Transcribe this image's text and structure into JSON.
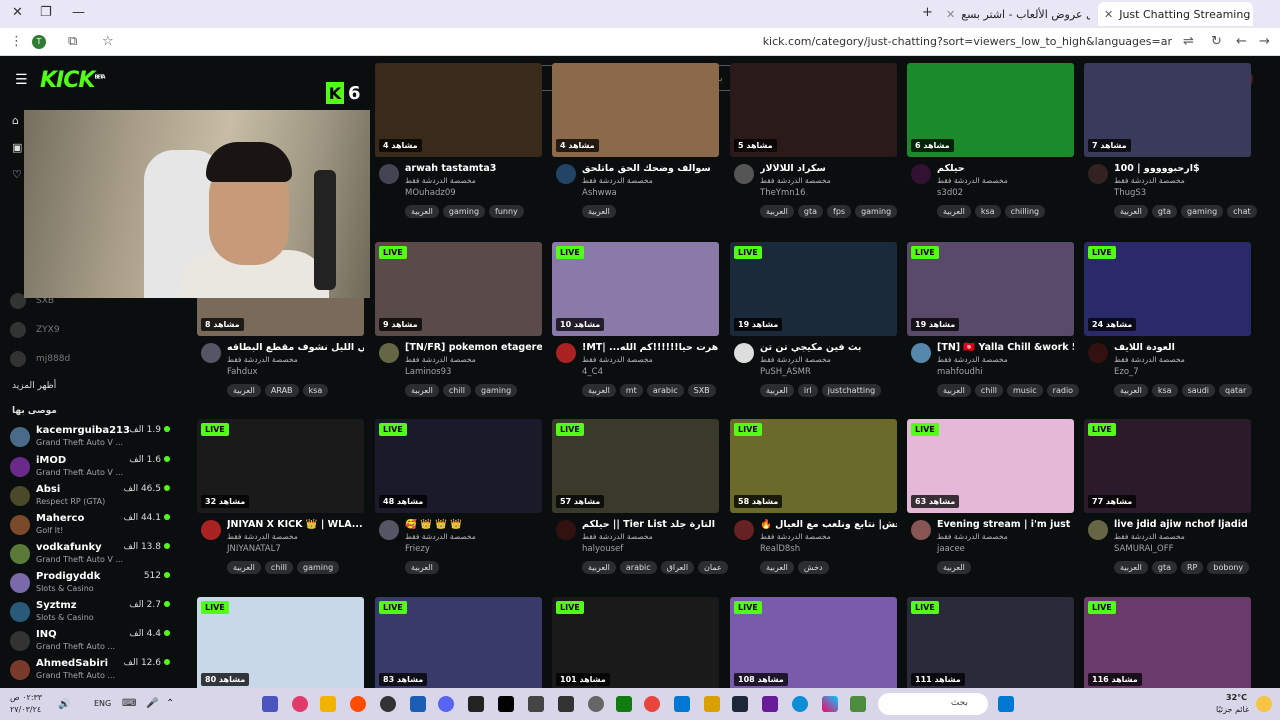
{
  "browser": {
    "tabs": [
      {
        "label": "Just Chatting Streaming - Live",
        "active": true
      },
      {
        "label": "أفضل عروض الألعاب - اشتر بسع",
        "active": false
      }
    ],
    "url": "kick.com/category/just-chatting?sort=viewers_low_to_high&languages=ar"
  },
  "kick": {
    "logo": "KICK",
    "logo_sup": "BETA",
    "search_placeholder": "بحث",
    "overlay_badge": "K",
    "overlay_count": "6"
  },
  "sidebar": {
    "offline": [
      "SXB",
      "ZYX9",
      "mj888d"
    ],
    "show_more": "أظهر المزيد",
    "recommended_heading": "موصى بها",
    "users": [
      {
        "name": "kacemrguiba213",
        "game": "Grand Theft Auto V ...",
        "viewers": "1.9 الف",
        "color": "#4a6a8a"
      },
      {
        "name": "iMOD",
        "game": "Grand Theft Auto V ...",
        "viewers": "1.6 الف",
        "color": "#6a2a8a"
      },
      {
        "name": "Absi",
        "game": "Respect RP (GTA)",
        "viewers": "46.5 الف",
        "color": "#4a4a2a"
      },
      {
        "name": "Maherco",
        "game": "Golf It!",
        "viewers": "44.1 الف",
        "color": "#7a4a2a"
      },
      {
        "name": "vodkafunky",
        "game": "Grand Theft Auto V ...",
        "viewers": "13.8 الف",
        "color": "#5a7a3a"
      },
      {
        "name": "Prodigyddk",
        "game": "Slots & Casino",
        "viewers": "512",
        "color": "#7a6aaa"
      },
      {
        "name": "Syztmz",
        "game": "Slots & Casino",
        "viewers": "2.7 الف",
        "color": "#2a5a7a"
      },
      {
        "name": "INQ",
        "game": "Grand Theft Auto ...",
        "viewers": "4.4 الف",
        "color": "#333333"
      },
      {
        "name": "AhmedSabiri",
        "game": "Grand Theft Auto ...",
        "viewers": "12.6 الف",
        "color": "#7a3a2a"
      }
    ]
  },
  "category_label": "مخصصة الدردشة فقط",
  "live_label": "LIVE",
  "rows": [
    [
      {
        "viewers": "4 مشاهد",
        "title": "arwah tastamta3",
        "user": "MOuhadz09",
        "tags": [
          "العربية",
          "gaming",
          "funny"
        ],
        "bg": "#3a2a1a",
        "av": "#445"
      },
      {
        "viewers": "4 مشاهد",
        "title": "سوالف وضحك الحق ماتلحق",
        "user": "Ashwwa",
        "tags": [
          "العربية"
        ],
        "bg": "#8a6a4a",
        "av": "#246"
      },
      {
        "viewers": "5 مشاهد",
        "title": "سكراد اللالالار",
        "user": "TheYmn16",
        "tags": [
          "العربية",
          "gta",
          "fps",
          "gaming"
        ],
        "bg": "#2a1a1a",
        "av": "#555"
      },
      {
        "viewers": "6 مشاهد",
        "title": "حيلكم",
        "user": "s3d02",
        "tags": [
          "العربية",
          "ksa",
          "chilling"
        ],
        "bg": "#1a8a2a",
        "av": "#313"
      },
      {
        "viewers": "7 مشاهد",
        "title": "ارحبووووو | 100$",
        "user": "ThugS3",
        "tags": [
          "العربية",
          "gta",
          "gaming",
          "chat"
        ],
        "bg": "#3a3a5a",
        "av": "#322"
      }
    ],
    [
      {
        "viewers": "8 مشاهد",
        "title": "بث تالي الليل نشوف مقطع البطاقه",
        "user": "Fahdux",
        "tags": [
          "العربية",
          "ARAB",
          "ksa"
        ],
        "bg": "#7a6a5a",
        "av": "#556"
      },
      {
        "viewers": "9 مشاهد",
        "title": "[TN/FR] pokemon etagere...",
        "user": "Laminos93",
        "tags": [
          "العربية",
          "chill",
          "gaming"
        ],
        "bg": "#5a4a4a",
        "av": "#664"
      },
      {
        "viewers": "10 مشاهد",
        "title": "!MT| ...لمتابعين كاهرت حيا!!!!!!كم الله",
        "user": "4_C4",
        "tags": [
          "العربية",
          "mt",
          "arabic",
          "SXB"
        ],
        "bg": "#8a7aaa",
        "av": "#a22"
      },
      {
        "viewers": "19 مشاهد",
        "title": "بث فين مكيجي تن تن",
        "user": "PuSH_ASMR",
        "tags": [
          "العربية",
          "irl",
          "justchatting"
        ],
        "bg": "#1a2a3a",
        "av": "#ddd"
      },
      {
        "viewers": "19 مشاهد",
        "title": "[TN] 🇹🇳 Yalla Chill &work 5...",
        "user": "mahfoudhi",
        "tags": [
          "العربية",
          "chill",
          "music",
          "radio"
        ],
        "bg": "#5a4a6a",
        "av": "#58a"
      },
      {
        "viewers": "24 مشاهد",
        "title": "العودة اللايف",
        "user": "Ezo_7",
        "tags": [
          "العربية",
          "ksa",
          "saudi",
          "qatar"
        ],
        "bg": "#2a2a6a",
        "av": "#311"
      }
    ],
    [
      {
        "viewers": "32 مشاهد",
        "title": "JNIYAN X KICK 👑 | WLA...",
        "user": "JNIYANATAL7",
        "tags": [
          "العربية",
          "chill",
          "gaming"
        ],
        "bg": "#1a1a1a",
        "av": "#a22"
      },
      {
        "viewers": "48 مشاهد",
        "title": "🥰 👑 👑 👑",
        "user": "Friezy",
        "tags": [
          "العربية"
        ],
        "bg": "#1a1a2a",
        "av": "#556"
      },
      {
        "viewers": "57 مشاهد",
        "title": "حيلكم || Tier List التارة جلد",
        "user": "halyousef",
        "tags": [
          "العربية",
          "arabic",
          "العراق",
          "عمان"
        ],
        "bg": "#3a3a2a",
        "av": "#311"
      },
      {
        "viewers": "58 مشاهد",
        "title": "🔥 دخش| نتابع ونلعب مع العيال",
        "user": "RealD8sh",
        "tags": [
          "العربية",
          "دخش"
        ],
        "bg": "#6a6a2a",
        "av": "#622"
      },
      {
        "viewers": "63 مشاهد",
        "title": "Evening stream | i'm just ...",
        "user": "jaacee",
        "tags": [
          "العربية"
        ],
        "bg": "#e6b8d8",
        "av": "#855"
      },
      {
        "viewers": "77 مشاهد",
        "title": "live jdid ajiw nchof ljadid !!!!",
        "user": "SAMURAI_OFF",
        "tags": [
          "العربية",
          "gta",
          "RP",
          "bobony"
        ],
        "bg": "#2a1a2a",
        "av": "#664"
      }
    ],
    [
      {
        "viewers": "80 مشاهد",
        "bg": "#c8d8e8"
      },
      {
        "viewers": "83 مشاهد",
        "bg": "#3a3a6a"
      },
      {
        "viewers": "101 مشاهد",
        "bg": "#1a1a1a"
      },
      {
        "viewers": "108 مشاهد",
        "bg": "#7a5aaa"
      },
      {
        "viewers": "111 مشاهد",
        "bg": "#2a2a3a"
      },
      {
        "viewers": "116 مشاهد",
        "bg": "#6a3a6a"
      }
    ]
  ],
  "taskbar": {
    "search": "بحث",
    "lang": "ENG",
    "time": "٠٢:٣٣ ص",
    "date": "٢٧/٠٣/٢٤",
    "weather_temp": "32°C",
    "weather_desc": "غائم جزئيًا"
  }
}
